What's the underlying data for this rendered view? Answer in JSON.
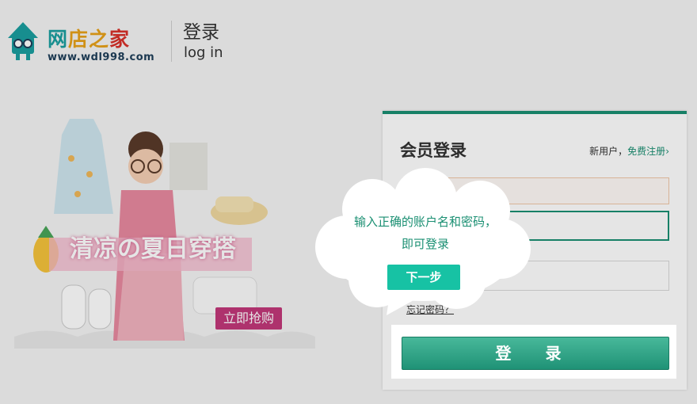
{
  "header": {
    "logo_text": [
      "网",
      "店之",
      "家"
    ],
    "logo_url": "www.wdl998.com",
    "title": "登录",
    "subtitle": "log in"
  },
  "promo": {
    "title": "清凉の夏日穿搭",
    "button": "立即抢购"
  },
  "login": {
    "title": "会员登录",
    "register_prompt": "新用户，",
    "register_link": "免费注册",
    "register_arrow": "›",
    "username_value": "",
    "password_value": "",
    "code_value": "",
    "forgot": "忘记密码？",
    "submit": "登 录"
  },
  "tooltip": {
    "message": "输入正确的账户名和密码，即可登录",
    "next": "下一步"
  },
  "colors": {
    "brand_green": "#1a8f72",
    "tip_button": "#17c2a4",
    "promo_pink": "#c2387a"
  }
}
